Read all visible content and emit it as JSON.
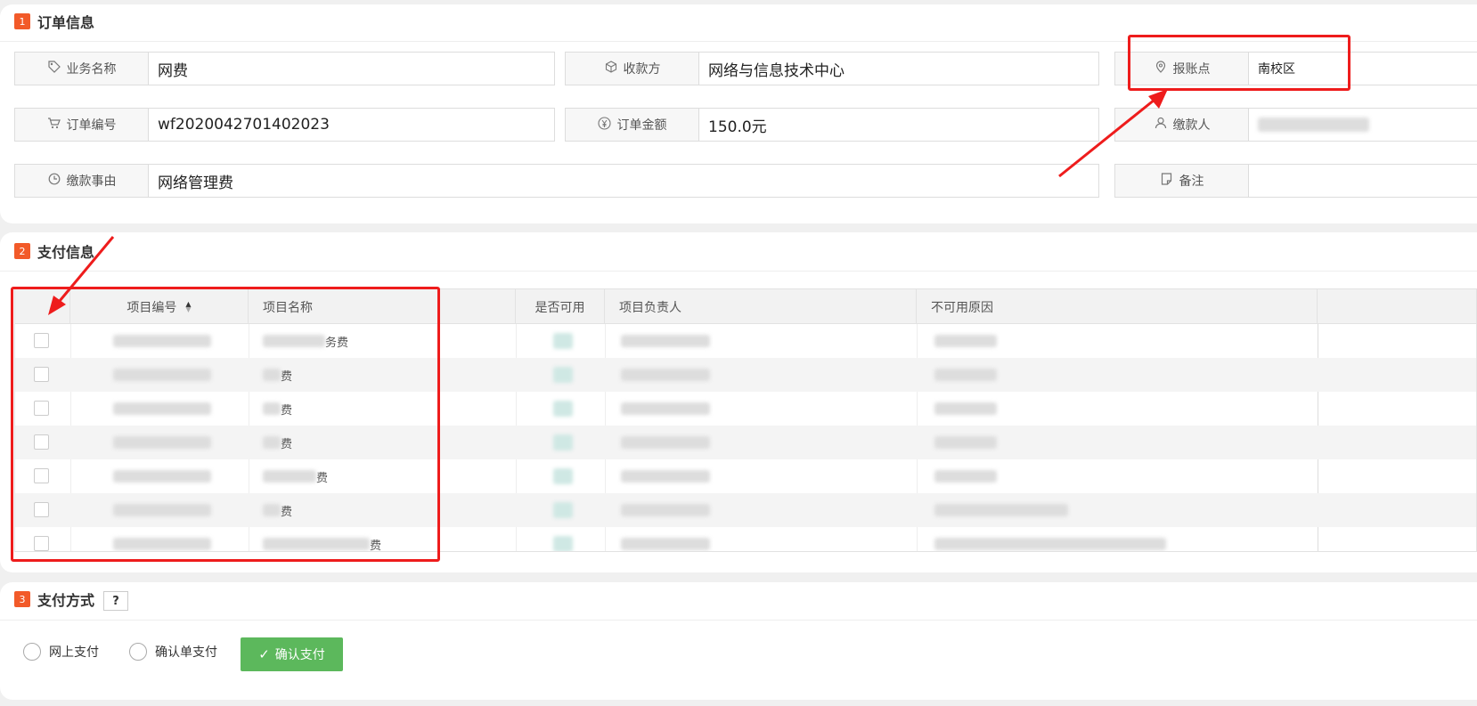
{
  "order_section": {
    "number": "1",
    "title": "订单信息",
    "fields": {
      "business_name": {
        "label": "业务名称",
        "value": "网费",
        "icon": "tag-icon"
      },
      "payee": {
        "label": "收款方",
        "value": "网络与信息技术中心",
        "icon": "cube-icon"
      },
      "report_point": {
        "label": "报账点",
        "value": "南校区",
        "icon": "location-pin-icon"
      },
      "order_number": {
        "label": "订单编号",
        "value": "wf2020042701402023",
        "icon": "cart-icon"
      },
      "order_amount": {
        "label": "订单金额",
        "value": "150.0元",
        "icon": "yuan-icon"
      },
      "payer": {
        "label": "缴款人",
        "value": "",
        "icon": "user-icon"
      },
      "payment_reason": {
        "label": "缴款事由",
        "value": "网络管理费",
        "icon": "clock-icon"
      },
      "remark": {
        "label": "备注",
        "value": "",
        "icon": "note-icon"
      }
    }
  },
  "payment_info_section": {
    "number": "2",
    "title": "支付信息",
    "table": {
      "headers": [
        "项目编号",
        "项目名称",
        "是否可用",
        "项目负责人",
        "不可用原因"
      ],
      "rows": [
        {
          "name_suffix": "务费"
        },
        {
          "name_suffix": "费"
        },
        {
          "name_suffix": "费"
        },
        {
          "name_suffix": "费"
        },
        {
          "name_suffix": "费"
        },
        {
          "name_suffix": "费"
        },
        {
          "name_suffix": "费"
        }
      ]
    }
  },
  "payment_method_section": {
    "number": "3",
    "title": "支付方式",
    "help_label": "?",
    "options": [
      "网上支付",
      "确认单支付"
    ],
    "confirm_button": "确认支付"
  },
  "colors": {
    "section_badge": "#f25a29",
    "annotation_red": "#ee1c1c",
    "confirm_green": "#5cb85c"
  }
}
